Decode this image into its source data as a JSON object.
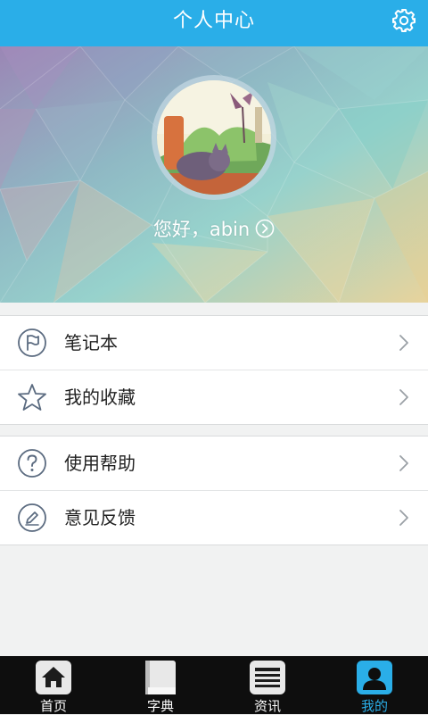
{
  "header": {
    "title": "个人中心",
    "settings_icon": "gear-icon"
  },
  "profile": {
    "greeting": "您好，abin",
    "avatar_icon": "avatar-image"
  },
  "menu_groups": [
    {
      "items": [
        {
          "label": "笔记本",
          "icon": "notebook-flag-icon"
        },
        {
          "label": "我的收藏",
          "icon": "star-icon"
        }
      ]
    },
    {
      "items": [
        {
          "label": "使用帮助",
          "icon": "help-icon"
        },
        {
          "label": "意见反馈",
          "icon": "feedback-pen-icon"
        }
      ]
    }
  ],
  "tabs": [
    {
      "label": "首页",
      "icon": "home-icon"
    },
    {
      "label": "字典",
      "icon": "book-icon"
    },
    {
      "label": "资讯",
      "icon": "news-icon"
    },
    {
      "label": "我的",
      "icon": "person-icon",
      "active": true
    }
  ],
  "colors": {
    "accent": "#2aaee8",
    "tabbar": "#0e0e0e",
    "page_bg": "#f1f2f2"
  }
}
